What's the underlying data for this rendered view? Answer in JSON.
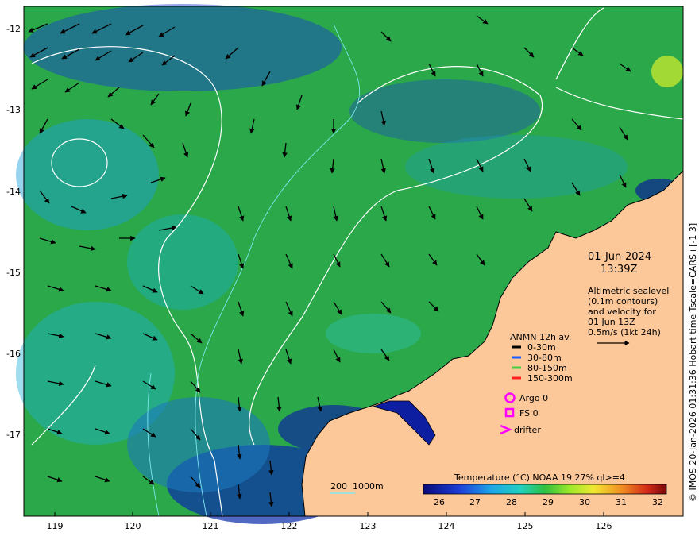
{
  "map": {
    "lon_ticks": [
      "119",
      "120",
      "121",
      "122",
      "123",
      "124",
      "125",
      "126"
    ],
    "lat_ticks": [
      "-12",
      "-13",
      "-14",
      "-15",
      "-16",
      "-17"
    ],
    "timestamp": {
      "date": "01-Jun-2024",
      "time": "13:39Z"
    },
    "altimetry_note": [
      "Altimetric sealevel",
      "(0.1m contours)",
      "and velocity for",
      "01 Jun 13Z",
      "0.5m/s (1kt 24h)"
    ],
    "anmn": {
      "title": "ANMN 12h av.",
      "items": [
        {
          "label": "0-30m",
          "color": "#000000"
        },
        {
          "label": "30-80m",
          "color": "#1f5cff"
        },
        {
          "label": "80-150m",
          "color": "#40d040"
        },
        {
          "label": "150-300m",
          "color": "#ff2020"
        }
      ]
    },
    "markers": [
      {
        "label": "Argo 0",
        "icon": "circle-icon",
        "color": "#ff00ff"
      },
      {
        "label": "FS 0",
        "icon": "square-icon",
        "color": "#ff00ff"
      },
      {
        "label": "drifter",
        "icon": "chevron-icon",
        "color": "#ff00ff"
      }
    ],
    "bathy_label": "200  1000m",
    "colorbar": {
      "title": "Temperature (°C) NOAA 19 27% ql>=4",
      "ticks": [
        "26",
        "27",
        "28",
        "29",
        "30",
        "31",
        "32"
      ]
    },
    "side_caption": "© IMOS 20-Jan-2026 01:31:36 Hobart time Tscale=CARS+[-1 3]",
    "colors": {
      "land": "#fcc89a",
      "ocean_mid": "#2aa84a",
      "coastline": "#000000",
      "contour": "#ffffff"
    }
  }
}
